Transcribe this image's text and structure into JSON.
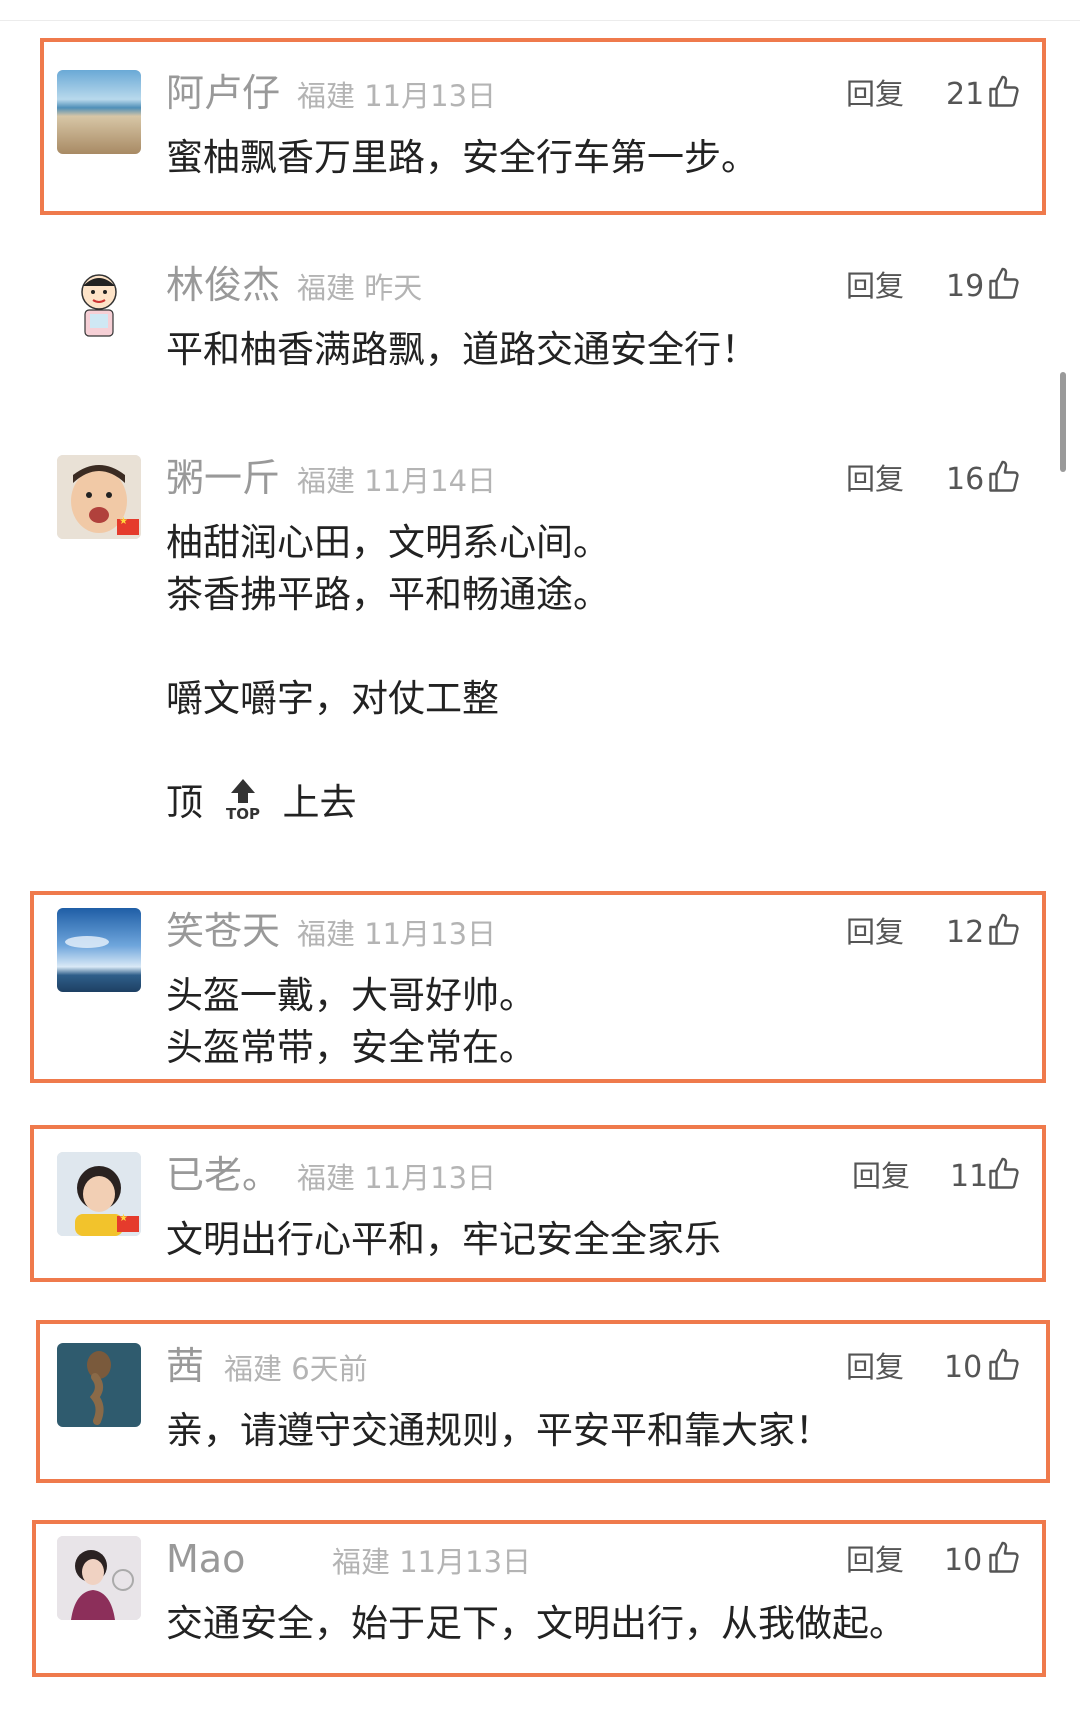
{
  "accent": "#ef7a4c",
  "reply_label": "回复",
  "comments": [
    {
      "avatar": "beach-photo-avatar",
      "name": "阿卢仔",
      "location": "福建",
      "time": "11月13日",
      "likes": "21",
      "lines": [
        "蜜柚飘香万里路，安全行车第一步。"
      ],
      "highlighted": true
    },
    {
      "avatar": "cartoon-kid-avatar",
      "name": "林俊杰",
      "location": "福建",
      "time": "昨天",
      "likes": "19",
      "lines": [
        "平和柚香满路飘，道路交通安全行！"
      ],
      "highlighted": false
    },
    {
      "avatar": "baby-photo-avatar",
      "name": "粥一斤",
      "location": "福建",
      "time": "11月14日",
      "likes": "16",
      "lines": [
        "柚甜润心田，文明系心间。",
        "茶香拂平路，平和畅通途。",
        "",
        "嚼文嚼字，对仗工整",
        "",
        "顶",
        "上去"
      ],
      "top_emoji": "TOP",
      "has_flag": true,
      "highlighted": false
    },
    {
      "avatar": "sky-sea-avatar",
      "name": "笑苍天",
      "location": "福建",
      "time": "11月13日",
      "likes": "12",
      "lines": [
        "头盔一戴，大哥好帅。",
        "头盔常带，安全常在。"
      ],
      "highlighted": true
    },
    {
      "avatar": "girl-photo-avatar",
      "name": "已老。",
      "location": "福建",
      "time": "11月13日",
      "likes": "11",
      "lines": [
        "文明出行心平和，牢记安全全家乐"
      ],
      "has_flag": true,
      "highlighted": true
    },
    {
      "avatar": "braid-illustration-avatar",
      "name": "茜",
      "location": "福建",
      "time": "6天前",
      "likes": "10",
      "lines": [
        "亲，请遵守交通规则，平安平和靠大家！"
      ],
      "highlighted": true
    },
    {
      "avatar": "woman-photo-avatar",
      "name": "Mao",
      "location": "福建",
      "time": "11月13日",
      "likes": "10",
      "lines": [
        "交通安全，始于足下，文明出行，从我做起。"
      ],
      "highlighted": true
    }
  ]
}
